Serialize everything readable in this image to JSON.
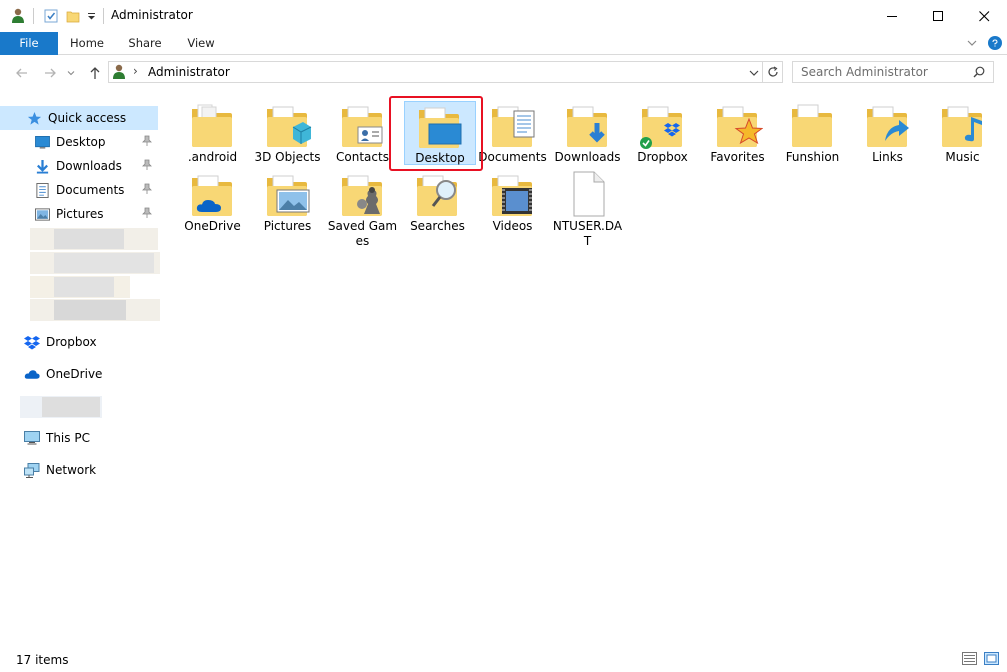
{
  "window": {
    "title": "Administrator",
    "controls": [
      "minimize",
      "maximize",
      "close"
    ]
  },
  "ribbon": {
    "tabs": [
      {
        "label": "File",
        "active": true
      },
      {
        "label": "Home"
      },
      {
        "label": "Share"
      },
      {
        "label": "View"
      }
    ]
  },
  "address": {
    "path": "Administrator",
    "separator": "›"
  },
  "search": {
    "placeholder": "Search Administrator"
  },
  "sidebar": {
    "quick_access": "Quick access",
    "pinned": [
      {
        "label": "Desktop",
        "icon": "desktop-icon"
      },
      {
        "label": "Downloads",
        "icon": "downloads-icon"
      },
      {
        "label": "Documents",
        "icon": "documents-icon"
      },
      {
        "label": "Pictures",
        "icon": "pictures-icon"
      }
    ],
    "dropbox": "Dropbox",
    "onedrive": "OneDrive",
    "this_pc": "This PC",
    "network": "Network"
  },
  "files": [
    {
      "name": ".android",
      "kind": "folder-plain"
    },
    {
      "name": "3D Objects",
      "kind": "folder-3d"
    },
    {
      "name": "Contacts",
      "kind": "folder-contacts"
    },
    {
      "name": "Desktop",
      "kind": "folder-desktop",
      "selected": true
    },
    {
      "name": "Documents",
      "kind": "folder-documents"
    },
    {
      "name": "Downloads",
      "kind": "folder-downloads"
    },
    {
      "name": "Dropbox",
      "kind": "folder-dropbox"
    },
    {
      "name": "Favorites",
      "kind": "folder-favorites"
    },
    {
      "name": "Funshion",
      "kind": "folder-funshion"
    },
    {
      "name": "Links",
      "kind": "folder-links"
    },
    {
      "name": "Music",
      "kind": "folder-music"
    },
    {
      "name": "OneDrive",
      "kind": "folder-onedrive"
    },
    {
      "name": "Pictures",
      "kind": "folder-pictures"
    },
    {
      "name": "Saved Games",
      "kind": "folder-saved-games"
    },
    {
      "name": "Searches",
      "kind": "folder-searches"
    },
    {
      "name": "Videos",
      "kind": "folder-videos"
    },
    {
      "name": "NTUSER.DAT",
      "kind": "file-blank"
    }
  ],
  "status": {
    "item_count": "17 items"
  },
  "colors": {
    "accent": "#1979ca",
    "selection": "#cce8ff",
    "folder": "#f8d775",
    "highlight_box": "#e81123"
  }
}
